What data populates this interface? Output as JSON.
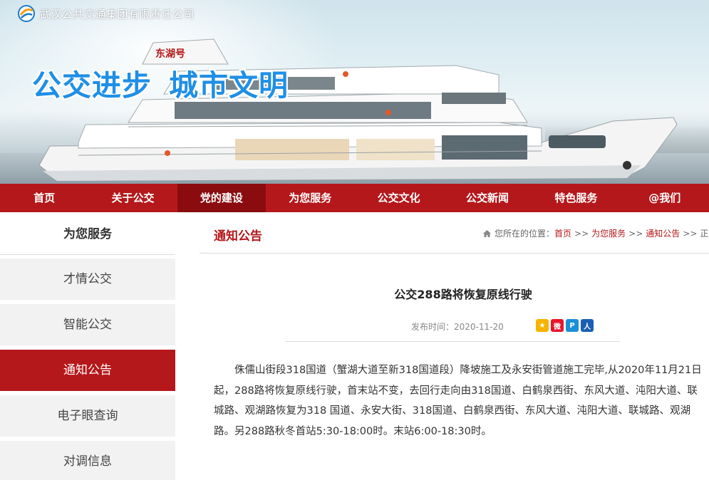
{
  "site": {
    "company_name": "武汉公共交通集团有限责任公司",
    "slogan_part1": "公交进步",
    "slogan_part2": "城市文明",
    "logo_icon": "bus-logo-icon",
    "brand_color": "#b5181b"
  },
  "nav": {
    "items": [
      {
        "label": "首页"
      },
      {
        "label": "关于公交"
      },
      {
        "label": "党的建设"
      },
      {
        "label": "为您服务"
      },
      {
        "label": "公交文化"
      },
      {
        "label": "公交新闻"
      },
      {
        "label": "特色服务"
      },
      {
        "label": "@我们"
      }
    ],
    "active_index": 2
  },
  "sidebar": {
    "title": "为您服务",
    "items": [
      {
        "label": "才情公交"
      },
      {
        "label": "智能公交"
      },
      {
        "label": "通知公告"
      },
      {
        "label": "电子眼查询"
      },
      {
        "label": "对调信息"
      }
    ],
    "active_index": 2
  },
  "main": {
    "section_title": "通知公告",
    "breadcrumb": {
      "prefix": "您所在的位置：",
      "home": "首页",
      "sep": ">>",
      "level1": "为您服务",
      "level2": "通知公告",
      "current": "正文"
    },
    "article": {
      "title": "公交288路将恢复原线行驶",
      "date_label": "发布时间：2020-11-20",
      "share_icons": [
        "qzone-icon",
        "weibo-icon",
        "tencent-weibo-icon",
        "renren-icon"
      ],
      "body": "侏儒山街段318国道（蟹湖大道至新318国道段）降坡施工及永安街管道施工完毕,从2020年11月21日起，288路将恢复原线行驶，首末站不变，去回行走向由318国道、白鹤泉西街、东风大道、沌阳大道、联城路、观湖路恢复为318 国道、永安大街、318国道、白鹤泉西街、东风大道、沌阳大道、联城路、观湖路。另288路秋冬首站5:30-18:00时。末站6:00-18:30时。"
    }
  }
}
